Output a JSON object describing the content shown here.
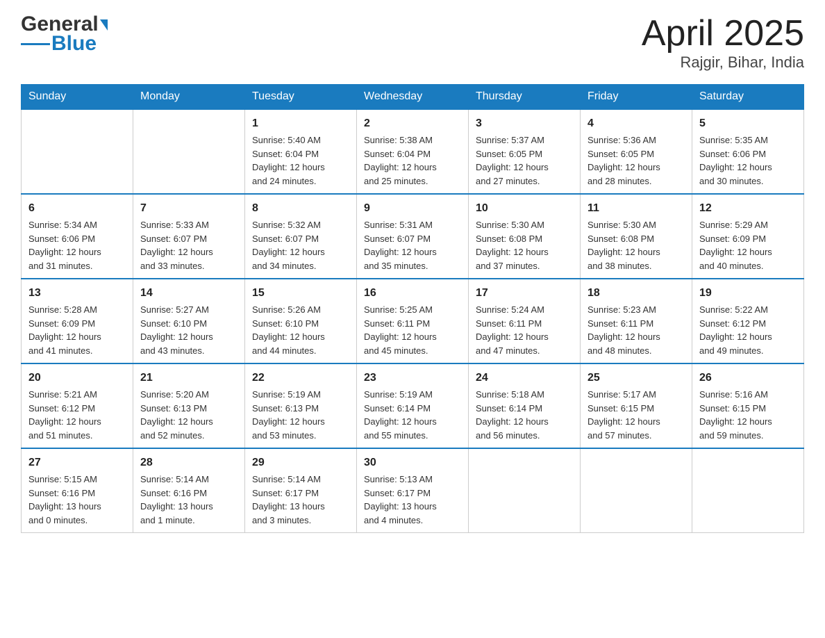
{
  "header": {
    "logo_general": "General",
    "logo_blue": "Blue",
    "title": "April 2025",
    "subtitle": "Rajgir, Bihar, India"
  },
  "days_of_week": [
    "Sunday",
    "Monday",
    "Tuesday",
    "Wednesday",
    "Thursday",
    "Friday",
    "Saturday"
  ],
  "weeks": [
    [
      {
        "day": "",
        "info": ""
      },
      {
        "day": "",
        "info": ""
      },
      {
        "day": "1",
        "info": "Sunrise: 5:40 AM\nSunset: 6:04 PM\nDaylight: 12 hours\nand 24 minutes."
      },
      {
        "day": "2",
        "info": "Sunrise: 5:38 AM\nSunset: 6:04 PM\nDaylight: 12 hours\nand 25 minutes."
      },
      {
        "day": "3",
        "info": "Sunrise: 5:37 AM\nSunset: 6:05 PM\nDaylight: 12 hours\nand 27 minutes."
      },
      {
        "day": "4",
        "info": "Sunrise: 5:36 AM\nSunset: 6:05 PM\nDaylight: 12 hours\nand 28 minutes."
      },
      {
        "day": "5",
        "info": "Sunrise: 5:35 AM\nSunset: 6:06 PM\nDaylight: 12 hours\nand 30 minutes."
      }
    ],
    [
      {
        "day": "6",
        "info": "Sunrise: 5:34 AM\nSunset: 6:06 PM\nDaylight: 12 hours\nand 31 minutes."
      },
      {
        "day": "7",
        "info": "Sunrise: 5:33 AM\nSunset: 6:07 PM\nDaylight: 12 hours\nand 33 minutes."
      },
      {
        "day": "8",
        "info": "Sunrise: 5:32 AM\nSunset: 6:07 PM\nDaylight: 12 hours\nand 34 minutes."
      },
      {
        "day": "9",
        "info": "Sunrise: 5:31 AM\nSunset: 6:07 PM\nDaylight: 12 hours\nand 35 minutes."
      },
      {
        "day": "10",
        "info": "Sunrise: 5:30 AM\nSunset: 6:08 PM\nDaylight: 12 hours\nand 37 minutes."
      },
      {
        "day": "11",
        "info": "Sunrise: 5:30 AM\nSunset: 6:08 PM\nDaylight: 12 hours\nand 38 minutes."
      },
      {
        "day": "12",
        "info": "Sunrise: 5:29 AM\nSunset: 6:09 PM\nDaylight: 12 hours\nand 40 minutes."
      }
    ],
    [
      {
        "day": "13",
        "info": "Sunrise: 5:28 AM\nSunset: 6:09 PM\nDaylight: 12 hours\nand 41 minutes."
      },
      {
        "day": "14",
        "info": "Sunrise: 5:27 AM\nSunset: 6:10 PM\nDaylight: 12 hours\nand 43 minutes."
      },
      {
        "day": "15",
        "info": "Sunrise: 5:26 AM\nSunset: 6:10 PM\nDaylight: 12 hours\nand 44 minutes."
      },
      {
        "day": "16",
        "info": "Sunrise: 5:25 AM\nSunset: 6:11 PM\nDaylight: 12 hours\nand 45 minutes."
      },
      {
        "day": "17",
        "info": "Sunrise: 5:24 AM\nSunset: 6:11 PM\nDaylight: 12 hours\nand 47 minutes."
      },
      {
        "day": "18",
        "info": "Sunrise: 5:23 AM\nSunset: 6:11 PM\nDaylight: 12 hours\nand 48 minutes."
      },
      {
        "day": "19",
        "info": "Sunrise: 5:22 AM\nSunset: 6:12 PM\nDaylight: 12 hours\nand 49 minutes."
      }
    ],
    [
      {
        "day": "20",
        "info": "Sunrise: 5:21 AM\nSunset: 6:12 PM\nDaylight: 12 hours\nand 51 minutes."
      },
      {
        "day": "21",
        "info": "Sunrise: 5:20 AM\nSunset: 6:13 PM\nDaylight: 12 hours\nand 52 minutes."
      },
      {
        "day": "22",
        "info": "Sunrise: 5:19 AM\nSunset: 6:13 PM\nDaylight: 12 hours\nand 53 minutes."
      },
      {
        "day": "23",
        "info": "Sunrise: 5:19 AM\nSunset: 6:14 PM\nDaylight: 12 hours\nand 55 minutes."
      },
      {
        "day": "24",
        "info": "Sunrise: 5:18 AM\nSunset: 6:14 PM\nDaylight: 12 hours\nand 56 minutes."
      },
      {
        "day": "25",
        "info": "Sunrise: 5:17 AM\nSunset: 6:15 PM\nDaylight: 12 hours\nand 57 minutes."
      },
      {
        "day": "26",
        "info": "Sunrise: 5:16 AM\nSunset: 6:15 PM\nDaylight: 12 hours\nand 59 minutes."
      }
    ],
    [
      {
        "day": "27",
        "info": "Sunrise: 5:15 AM\nSunset: 6:16 PM\nDaylight: 13 hours\nand 0 minutes."
      },
      {
        "day": "28",
        "info": "Sunrise: 5:14 AM\nSunset: 6:16 PM\nDaylight: 13 hours\nand 1 minute."
      },
      {
        "day": "29",
        "info": "Sunrise: 5:14 AM\nSunset: 6:17 PM\nDaylight: 13 hours\nand 3 minutes."
      },
      {
        "day": "30",
        "info": "Sunrise: 5:13 AM\nSunset: 6:17 PM\nDaylight: 13 hours\nand 4 minutes."
      },
      {
        "day": "",
        "info": ""
      },
      {
        "day": "",
        "info": ""
      },
      {
        "day": "",
        "info": ""
      }
    ]
  ]
}
